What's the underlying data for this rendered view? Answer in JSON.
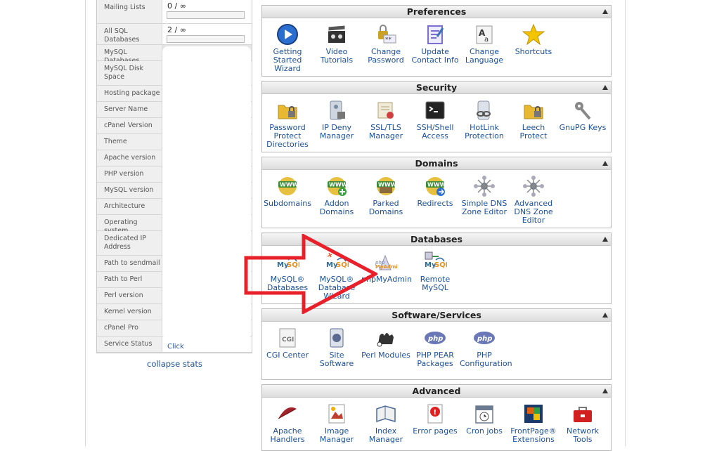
{
  "stats": {
    "rows": [
      {
        "label": "Mailing Lists",
        "value": "0 / ∞"
      },
      {
        "label": "All SQL Databases",
        "value": "2 / ∞"
      },
      {
        "label": "MySQL Databases",
        "value": ""
      },
      {
        "label": "MySQL Disk Space",
        "value": ""
      },
      {
        "label": "Hosting package",
        "value": ""
      },
      {
        "label": "Server Name",
        "value": ""
      },
      {
        "label": "cPanel Version",
        "value": ""
      },
      {
        "label": "Theme",
        "value": ""
      },
      {
        "label": "Apache version",
        "value": ""
      },
      {
        "label": "PHP version",
        "value": ""
      },
      {
        "label": "MySQL version",
        "value": ""
      },
      {
        "label": "Architecture",
        "value": ""
      },
      {
        "label": "Operating system",
        "value": ""
      },
      {
        "label": "Dedicated IP Address",
        "value": ""
      },
      {
        "label": "Path to sendmail",
        "value": ""
      },
      {
        "label": "Path to Perl",
        "value": ""
      },
      {
        "label": "Perl version",
        "value": ""
      },
      {
        "label": "Kernel version",
        "value": ""
      },
      {
        "label": "cPanel Pro",
        "value": ""
      },
      {
        "label": "Service Status",
        "value": "Click"
      }
    ],
    "collapse": "collapse stats"
  },
  "panels": {
    "preferences": {
      "title": "Preferences",
      "items": [
        {
          "label": "Getting Started Wizard",
          "icon": "play-icon",
          "color": "#2a6fd0"
        },
        {
          "label": "Video Tutorials",
          "icon": "clapperboard-icon",
          "color": "#333333"
        },
        {
          "label": "Change Password",
          "icon": "lock-icon",
          "color": "#c9a227"
        },
        {
          "label": "Update Contact Info",
          "icon": "contact-card-icon",
          "color": "#7b6fd0"
        },
        {
          "label": "Change Language",
          "icon": "language-icon",
          "color": "#666666"
        },
        {
          "label": "Shortcuts",
          "icon": "star-icon",
          "color": "#f2c500"
        }
      ]
    },
    "security": {
      "title": "Security",
      "items": [
        {
          "label": "Password Protect Directories",
          "icon": "folder-lock-icon",
          "color": "#e8b830"
        },
        {
          "label": "IP Deny Manager",
          "icon": "server-lock-icon",
          "color": "#7a8aa0"
        },
        {
          "label": "SSL/TLS Manager",
          "icon": "certificate-icon",
          "color": "#b0a070"
        },
        {
          "label": "SSH/Shell Access",
          "icon": "terminal-icon",
          "color": "#222222"
        },
        {
          "label": "HotLink Protection",
          "icon": "chain-icon",
          "color": "#8890a0"
        },
        {
          "label": "Leech Protect",
          "icon": "folder-lock-icon",
          "color": "#e8b830"
        },
        {
          "label": "GnuPG Keys",
          "icon": "keys-icon",
          "color": "#888888"
        }
      ]
    },
    "domains": {
      "title": "Domains",
      "items": [
        {
          "label": "Subdomains",
          "icon": "www-globe-icon",
          "color": "#3a8a3a"
        },
        {
          "label": "Addon Domains",
          "icon": "www-add-icon",
          "color": "#3a8a3a"
        },
        {
          "label": "Parked Domains",
          "icon": "www-parked-icon",
          "color": "#3a8a3a"
        },
        {
          "label": "Redirects",
          "icon": "www-redirect-icon",
          "color": "#3a8a3a"
        },
        {
          "label": "Simple DNS Zone Editor",
          "icon": "dns-network-icon",
          "color": "#6a7a90"
        },
        {
          "label": "Advanced DNS Zone Editor",
          "icon": "dns-network-icon",
          "color": "#6a7a90"
        }
      ]
    },
    "databases": {
      "title": "Databases",
      "items": [
        {
          "label": "MySQL® Databases",
          "icon": "mysql-icon",
          "color": "#2a6a9a"
        },
        {
          "label": "MySQL® Database Wizard",
          "icon": "mysql-wizard-icon",
          "color": "#2a6a9a"
        },
        {
          "label": "phpMyAdmin",
          "icon": "phpmyadmin-icon",
          "color": "#6a78b8"
        },
        {
          "label": "Remote MySQL",
          "icon": "remote-mysql-icon",
          "color": "#2a6a9a"
        }
      ]
    },
    "software": {
      "title": "Software/Services",
      "items": [
        {
          "label": "CGI Center",
          "icon": "cgi-icon",
          "color": "#777777"
        },
        {
          "label": "Site Software",
          "icon": "site-software-icon",
          "color": "#5a6a90"
        },
        {
          "label": "Perl Modules",
          "icon": "camel-icon",
          "color": "#333333"
        },
        {
          "label": "PHP PEAR Packages",
          "icon": "php-icon",
          "color": "#6a78b8"
        },
        {
          "label": "PHP Configuration",
          "icon": "php-icon",
          "color": "#6a78b8"
        }
      ]
    },
    "advanced": {
      "title": "Advanced",
      "items": [
        {
          "label": "Apache Handlers",
          "icon": "feather-icon",
          "color": "#a0222a"
        },
        {
          "label": "Image Manager",
          "icon": "image-icon",
          "color": "#c04030"
        },
        {
          "label": "Index Manager",
          "icon": "book-icon",
          "color": "#4a6a9a"
        },
        {
          "label": "Error pages",
          "icon": "error-page-icon",
          "color": "#e02020"
        },
        {
          "label": "Cron jobs",
          "icon": "calendar-icon",
          "color": "#6a7a90"
        },
        {
          "label": "FrontPage® Extensions",
          "icon": "frontpage-icon",
          "color": "#e06010"
        },
        {
          "label": "Network Tools",
          "icon": "toolbox-icon",
          "color": "#d02020"
        }
      ]
    }
  },
  "annotation": {
    "color": "#e8202a"
  }
}
